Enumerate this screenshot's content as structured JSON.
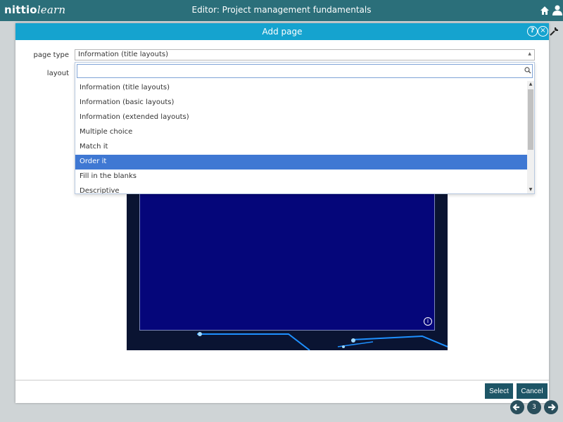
{
  "app": {
    "logo_main": "nittio",
    "logo_sub": "learn",
    "title": "Editor: Project management fundamentals"
  },
  "modal": {
    "title": "Add page",
    "help_glyph": "?",
    "close_glyph": "×"
  },
  "form": {
    "page_type_label": "page type",
    "layout_label": "layout",
    "page_type_value": "Information (title layouts)",
    "search_value": ""
  },
  "dropdown": {
    "options": [
      "Information (title layouts)",
      "Information (basic layouts)",
      "Information (extended layouts)",
      "Multiple choice",
      "Match it",
      "Order it",
      "Fill in the blanks",
      "Descriptive"
    ],
    "selected": "Order it"
  },
  "preview": {
    "info_glyph": "i"
  },
  "footer": {
    "select_label": "Select",
    "cancel_label": "Cancel"
  },
  "nav": {
    "page_number": "3"
  },
  "colors": {
    "app_bar": "#2b6f7a",
    "modal_header": "#15a3cf",
    "selected_option": "#3f78d3",
    "button": "#1d5566",
    "preview_blue": "#05067a"
  }
}
